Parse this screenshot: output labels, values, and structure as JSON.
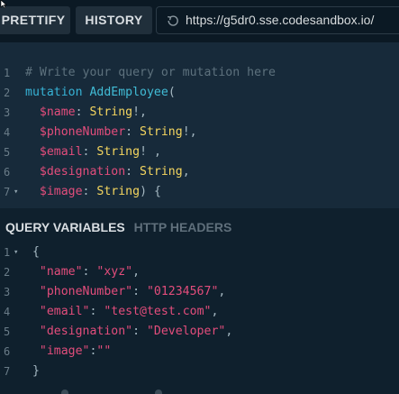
{
  "toolbar": {
    "prettify_label": "PRETTIFY",
    "history_label": "HISTORY",
    "url": "https://g5dr0.sse.codesandbox.io/"
  },
  "editor": {
    "lines": [
      {
        "n": "1",
        "parts": [
          {
            "t": "# Write your query or mutation here",
            "c": "comment"
          }
        ]
      },
      {
        "n": "2",
        "parts": [
          {
            "t": "mutation ",
            "c": "keyword"
          },
          {
            "t": "AddEmployee",
            "c": "def"
          },
          {
            "t": "(",
            "c": "punct"
          }
        ]
      },
      {
        "n": "3",
        "parts": [
          {
            "t": "  $name",
            "c": "var"
          },
          {
            "t": ": ",
            "c": "punct"
          },
          {
            "t": "String",
            "c": "type"
          },
          {
            "t": "!,",
            "c": "punct"
          }
        ]
      },
      {
        "n": "4",
        "parts": [
          {
            "t": "  $phoneNumber",
            "c": "var"
          },
          {
            "t": ": ",
            "c": "punct"
          },
          {
            "t": "String",
            "c": "type"
          },
          {
            "t": "!,",
            "c": "punct"
          }
        ]
      },
      {
        "n": "5",
        "parts": [
          {
            "t": "  $email",
            "c": "var"
          },
          {
            "t": ": ",
            "c": "punct"
          },
          {
            "t": "String",
            "c": "type"
          },
          {
            "t": "! ,",
            "c": "punct"
          }
        ]
      },
      {
        "n": "6",
        "parts": [
          {
            "t": "  $designation",
            "c": "var"
          },
          {
            "t": ": ",
            "c": "punct"
          },
          {
            "t": "String",
            "c": "type"
          },
          {
            "t": ",",
            "c": "punct"
          }
        ]
      },
      {
        "n": "7",
        "fold": true,
        "parts": [
          {
            "t": "  $image",
            "c": "var"
          },
          {
            "t": ": ",
            "c": "punct"
          },
          {
            "t": "String",
            "c": "type"
          },
          {
            "t": ") {",
            "c": "punct"
          }
        ]
      }
    ]
  },
  "variables_panel": {
    "tab_query_variables": "QUERY VARIABLES",
    "tab_http_headers": "HTTP HEADERS",
    "lines": [
      {
        "n": "1",
        "fold": true,
        "parts": [
          {
            "t": " {",
            "c": "punct"
          }
        ]
      },
      {
        "n": "2",
        "parts": [
          {
            "t": "  \"name\"",
            "c": "key"
          },
          {
            "t": ": ",
            "c": "punct"
          },
          {
            "t": "\"xyz\"",
            "c": "str"
          },
          {
            "t": ",",
            "c": "punct"
          }
        ]
      },
      {
        "n": "3",
        "parts": [
          {
            "t": "  \"phoneNumber\"",
            "c": "key"
          },
          {
            "t": ": ",
            "c": "punct"
          },
          {
            "t": "\"01234567\"",
            "c": "str"
          },
          {
            "t": ",",
            "c": "punct"
          }
        ]
      },
      {
        "n": "4",
        "parts": [
          {
            "t": "  \"email\"",
            "c": "key"
          },
          {
            "t": ": ",
            "c": "punct"
          },
          {
            "t": "\"test@test.com\"",
            "c": "str"
          },
          {
            "t": ",",
            "c": "punct"
          }
        ]
      },
      {
        "n": "5",
        "parts": [
          {
            "t": "  \"designation\"",
            "c": "key"
          },
          {
            "t": ": ",
            "c": "punct"
          },
          {
            "t": "\"Developer\"",
            "c": "str"
          },
          {
            "t": ",",
            "c": "punct"
          }
        ]
      },
      {
        "n": "6",
        "parts": [
          {
            "t": "  \"image\"",
            "c": "key"
          },
          {
            "t": ":",
            "c": "punct"
          },
          {
            "t": "\"\"",
            "c": "str"
          }
        ]
      },
      {
        "n": "7",
        "parts": [
          {
            "t": " }",
            "c": "punct"
          }
        ]
      }
    ]
  },
  "colors": {
    "background": "#172a3a",
    "toolbar_bg": "#0b1924",
    "comment": "#5d717d",
    "keyword": "#37b3d6",
    "variable": "#e34d7c",
    "type": "#f5d65f"
  },
  "icons": {
    "history": "history-icon",
    "cursor": "mouse-cursor-icon"
  }
}
